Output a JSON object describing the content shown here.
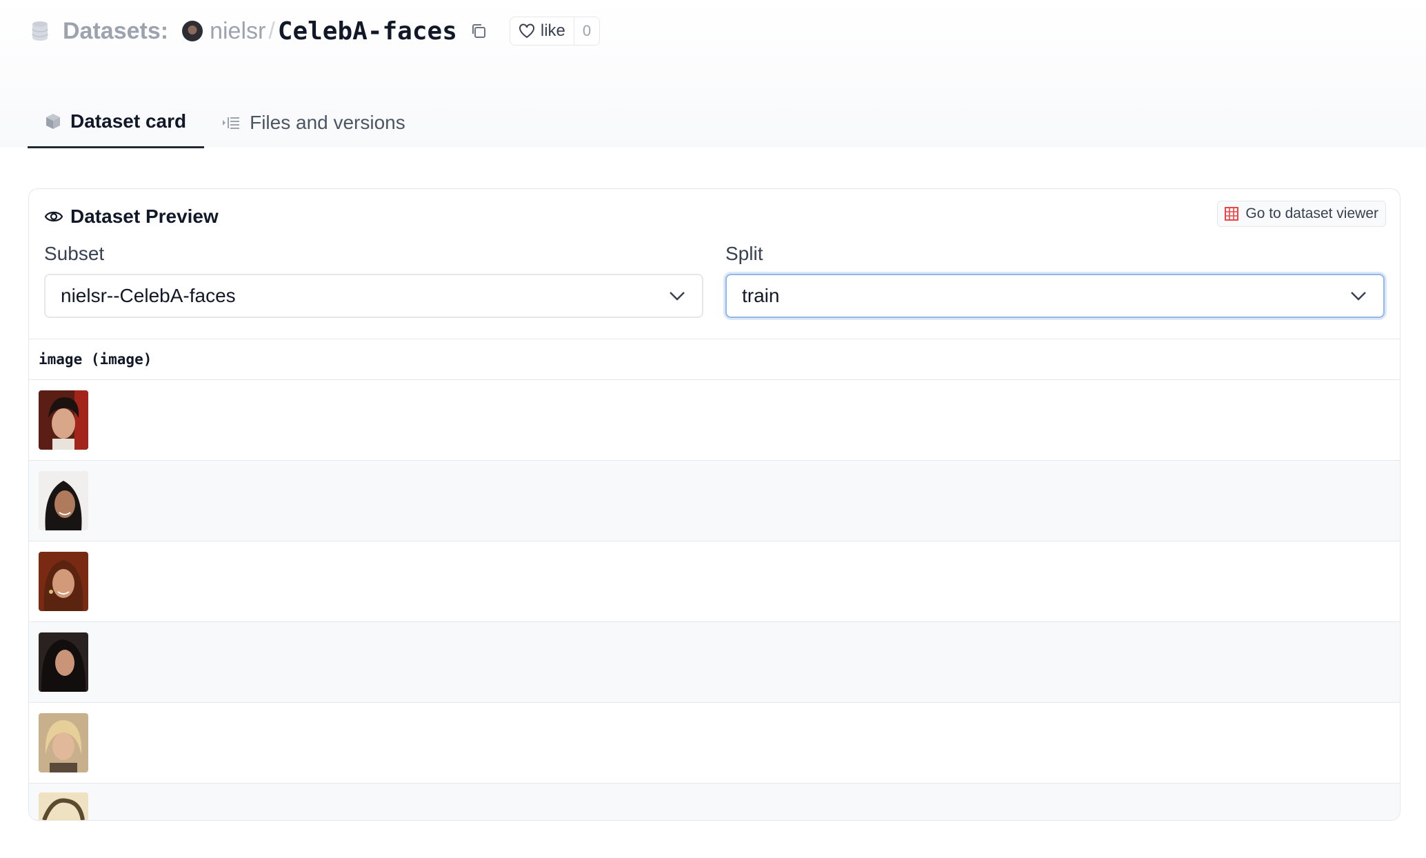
{
  "header": {
    "section_label": "Datasets:",
    "owner": "nielsr",
    "separator": "/",
    "repo_name": "CelebA-faces",
    "like_label": "like",
    "like_count": "0"
  },
  "tabs": [
    {
      "label": "Dataset card",
      "icon": "cube-icon",
      "active": true
    },
    {
      "label": "Files and versions",
      "icon": "files-list-icon",
      "active": false
    }
  ],
  "preview": {
    "title": "Dataset Preview",
    "viewer_button_label": "Go to dataset viewer",
    "subset_label": "Subset",
    "subset_value": "nielsr--CelebA-faces",
    "split_label": "Split",
    "split_value": "train",
    "column_header": "image (image)",
    "rows": [
      {
        "thumb": "face-dark-hair-red-background"
      },
      {
        "thumb": "face-long-dark-hair-light-background"
      },
      {
        "thumb": "face-brown-hair-earrings"
      },
      {
        "thumb": "face-dark-hair-dark-background"
      },
      {
        "thumb": "face-blonde-short-hair"
      },
      {
        "thumb": "face-partial-light"
      }
    ]
  },
  "colors": {
    "accent_focus": "#93b7e8",
    "viewer_icon": "#ef4444",
    "tab_underline": "#1f2937"
  }
}
